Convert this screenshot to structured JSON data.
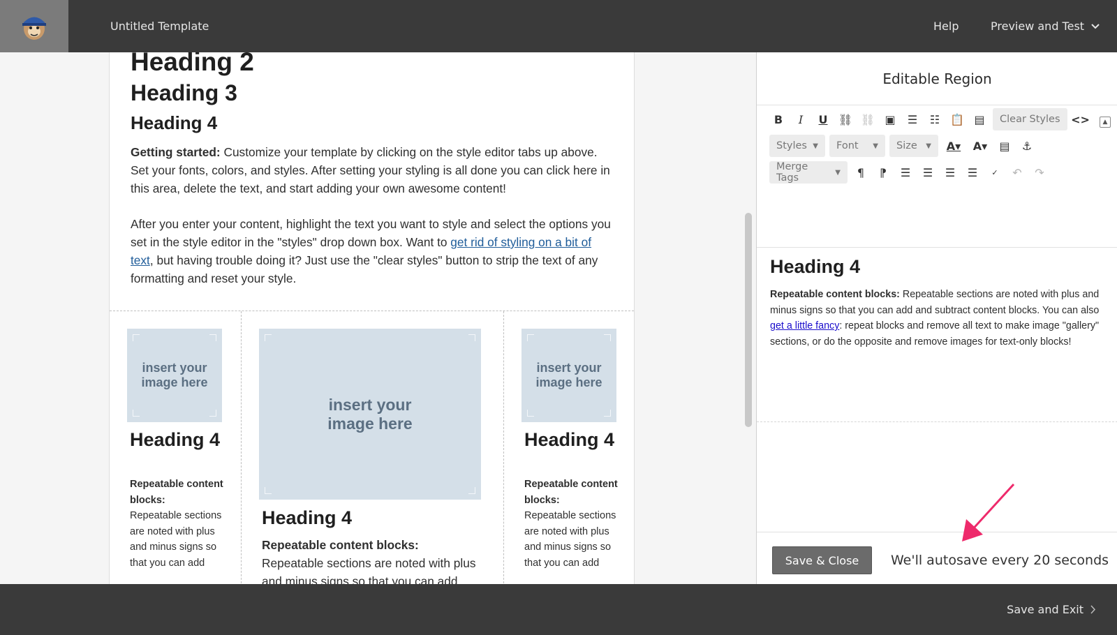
{
  "header": {
    "title": "Untitled Template",
    "help": "Help",
    "preview": "Preview and Test"
  },
  "email": {
    "heading2": "Heading 2",
    "heading3": "Heading 3",
    "heading4": "Heading 4",
    "intro_bold": "Getting started:",
    "intro_text": " Customize your template by clicking on the style editor tabs up above. Set your fonts, colors, and styles. After setting your styling is all done you can click here in this area, delete the text, and start adding your own awesome content!",
    "intro2_before": "After you enter your content, highlight the text you want to style and select the options you set in the style editor in the \"styles\" drop down box. Want to ",
    "intro2_link": "get rid of styling on a bit of text",
    "intro2_after": ", but having trouble doing it? Just use the \"clear styles\" button to strip the text of any formatting and reset your style.",
    "columns": [
      {
        "image_text": "insert your image here",
        "heading": "Heading 4",
        "bold": "Repeatable content blocks:",
        "text": "Repeatable sections are noted with plus and minus signs so that you can add"
      },
      {
        "image_text": "insert your image here",
        "heading": "Heading 4",
        "bold": "Repeatable content blocks:",
        "text": "Repeatable sections are noted with plus and minus signs so that you can add"
      },
      {
        "image_text": "insert your image here",
        "heading": "Heading 4",
        "bold": "Repeatable content blocks:",
        "text": "Repeatable sections are noted with plus and minus signs so that you can add"
      }
    ]
  },
  "panel": {
    "title": "Editable Region",
    "toolbar": {
      "clear_styles": "Clear Styles",
      "styles": "Styles",
      "font": "Font",
      "size": "Size",
      "merge_tags": "Merge Tags"
    },
    "editor": {
      "heading": "Heading 4",
      "bold": "Repeatable content blocks:",
      "text_before": " Repeatable sections are noted with plus and minus signs so that you can add and subtract content blocks. You can also ",
      "link": "get a little fancy",
      "text_after": ": repeat blocks and remove all text to make image \"gallery\" sections, or do the opposite and remove images for text-only blocks!"
    },
    "footer": {
      "save_close": "Save & Close",
      "autosave": "We'll autosave every 20 seconds"
    }
  },
  "bottom": {
    "save_exit": "Save and Exit"
  },
  "colors": {
    "bar": "#3a3a3a",
    "accent_arrow": "#ee2a6b",
    "link": "#1f5c99"
  }
}
